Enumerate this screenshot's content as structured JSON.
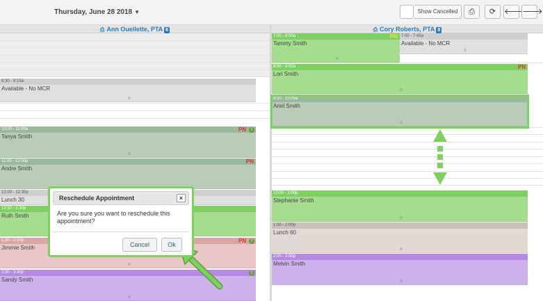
{
  "toolbar": {
    "date_label": "Thursday, June 28 2018",
    "show_cancelled_label": "Show Cancelled",
    "print_icon": "print-icon",
    "refresh_icon": "refresh-icon",
    "prev_icon": "arrow-left-icon",
    "next_icon": "arrow-right-icon"
  },
  "columns": [
    {
      "provider": "Ann Ouellette, PTA",
      "badge": "6"
    },
    {
      "provider": "Cory Roberts, PTA",
      "badge": "8"
    }
  ],
  "appointments_left": [
    {
      "time": "9:30 - 9:15a",
      "name": "Available - No MCR"
    },
    {
      "time": "10:00 - 11:00a",
      "name": "Tanya Smith",
      "pn": "PN"
    },
    {
      "time": "11:00 - 12:00p",
      "name": "Andre Smith",
      "pn": "PN"
    },
    {
      "time": "12:00 - 12:30p",
      "name": "Lunch 30"
    },
    {
      "time": "12:30 - 1:30p",
      "name": "Ruth Smith"
    },
    {
      "time": "1:30 - 2:30p",
      "name": "Jimmie Smith",
      "pn": "PN"
    },
    {
      "time": "2:30 - 3:30p",
      "name": "Sandy Smith"
    }
  ],
  "appointments_right": [
    {
      "time": "7:00 - 8:00a",
      "name": "Tammy Smith",
      "pn": "PN"
    },
    {
      "time": "7:00 - 7:45a",
      "name": "Available - No MCR"
    },
    {
      "time": "8:00 - 9:00a",
      "name": "Lori Smith",
      "pn": "PN"
    },
    {
      "time": "9:00 - 10:00a",
      "name": "Ariel Smith"
    },
    {
      "time": "12:00 - 1:00p",
      "name": "Stephanie Smith"
    },
    {
      "time": "1:00 - 2:00p",
      "name": "Lunch 60"
    },
    {
      "time": "2:00 - 3:00p",
      "name": "Melvin Smith"
    }
  ],
  "dialog": {
    "title": "Reschedule Appointment",
    "close_label": "×",
    "message": "Are you sure you want to reschedule this appointment?",
    "cancel_label": "Cancel",
    "ok_label": "Ok"
  },
  "colors": {
    "accent": "#2a7ab8",
    "highlight": "#7fcf62",
    "pn_red": "#d9342b"
  }
}
